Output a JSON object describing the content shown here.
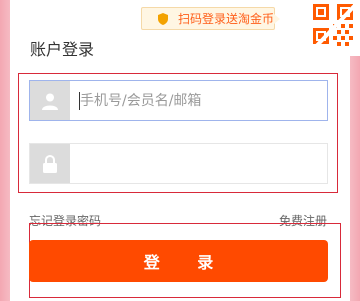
{
  "promo": {
    "text": "扫码登录送淘金币",
    "icon": "shield-icon"
  },
  "login": {
    "title": "账户登录",
    "username_placeholder": "手机号/会员名/邮箱",
    "username_value": "",
    "password_value": "",
    "forgot_password": "忘记登录密码",
    "register": "免费注册",
    "submit_label": "登 录"
  },
  "icons": {
    "username": "user-icon",
    "password": "lock-icon",
    "qr": "qr-code-icon"
  },
  "colors": {
    "accent": "#ff4a00",
    "border_highlight": "#d82a3a",
    "promo_text": "#ff5f1a",
    "icon_bg": "#dcdcdc",
    "input_focus_border": "#9fb4ec"
  }
}
